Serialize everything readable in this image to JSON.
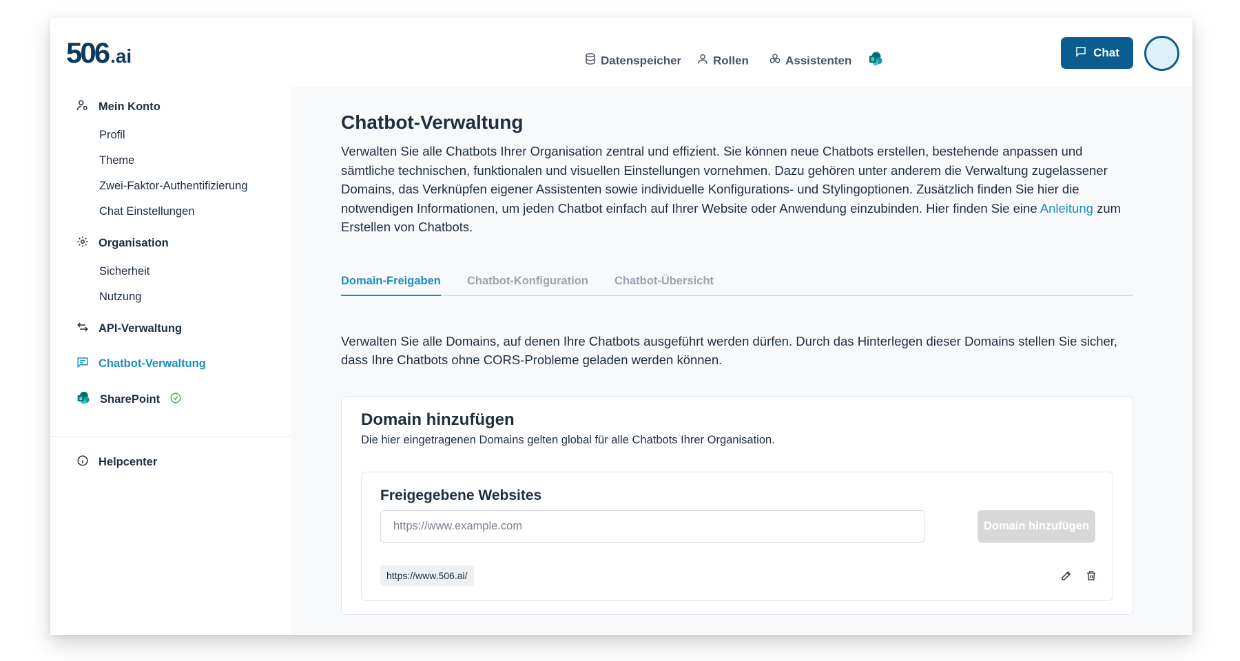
{
  "brand": {
    "logo_number": "506",
    "logo_suffix": ".ai"
  },
  "topnav": {
    "items": [
      {
        "label": "Datenspeicher",
        "icon": "database-icon"
      },
      {
        "label": "Rollen",
        "icon": "user-icon"
      },
      {
        "label": "Assistenten",
        "icon": "assistants-icon"
      }
    ],
    "sharepoint_icon": "sharepoint-icon",
    "chat_label": "Chat"
  },
  "sidebar": {
    "sections": [
      {
        "label": "Mein Konto",
        "icon": "user-settings-icon"
      },
      {
        "label": "Organisation",
        "icon": "gear-icon"
      },
      {
        "label": "API-Verwaltung",
        "icon": "swap-arrows-icon"
      },
      {
        "label": "Chatbot-Verwaltung",
        "icon": "chat-lines-icon",
        "active": true
      },
      {
        "label": "SharePoint",
        "icon": "sharepoint-icon",
        "badge": "check-circle-icon"
      },
      {
        "label": "Helpcenter",
        "icon": "info-icon"
      }
    ],
    "mein_konto_items": [
      "Profil",
      "Theme",
      "Zwei-Faktor-Authentifizierung",
      "Chat Einstellungen"
    ],
    "organisation_items": [
      "Sicherheit",
      "Nutzung"
    ]
  },
  "main": {
    "title": "Chatbot-Verwaltung",
    "intro_text": "Verwalten Sie alle Chatbots Ihrer Organisation zentral und effizient. Sie können neue Chatbots erstellen, bestehende anpassen und sämtliche technischen, funktionalen und visuellen Einstellungen vornehmen. Dazu gehören unter anderem die Verwaltung zugelassener Domains, das Verknüpfen eigener Assistenten sowie individuelle Konfigurations- und Stylingoptionen. Zusätzlich finden Sie hier die notwendigen Informationen, um jeden Chatbot einfach auf Ihrer Website oder Anwendung einzubinden. Hier finden Sie eine",
    "intro_link": "Anleitung",
    "intro_suffix": "zum Erstellen von Chatbots.",
    "tabs": [
      {
        "label": "Domain-Freigaben",
        "active": true
      },
      {
        "label": "Chatbot-Konfiguration",
        "active": false
      },
      {
        "label": "Chatbot-Übersicht",
        "active": false
      }
    ],
    "tab_description": "Verwalten Sie alle Domains, auf denen Ihre Chatbots ausgeführt werden dürfen. Durch das Hinterlegen dieser Domains stellen Sie sicher, dass Ihre Chatbots ohne CORS-Probleme geladen werden können.",
    "card": {
      "title": "Domain hinzufügen",
      "subtitle": "Die hier eingetragenen Domains gelten global für alle Chatbots Ihrer Organisation.",
      "inner_title": "Freigegebene Websites",
      "input_value": "",
      "input_placeholder": "https://www.example.com",
      "add_button": "Domain hinzufügen",
      "domains": [
        {
          "url": "https://www.506.ai/"
        }
      ]
    }
  },
  "colors": {
    "accent": "#1a8fbf",
    "primary_button": "#0b5c8f",
    "disabled_button": "#d8d8d8",
    "text": "#1f2d3d",
    "muted_tab": "#9aa4ae",
    "success": "#4caf50"
  }
}
